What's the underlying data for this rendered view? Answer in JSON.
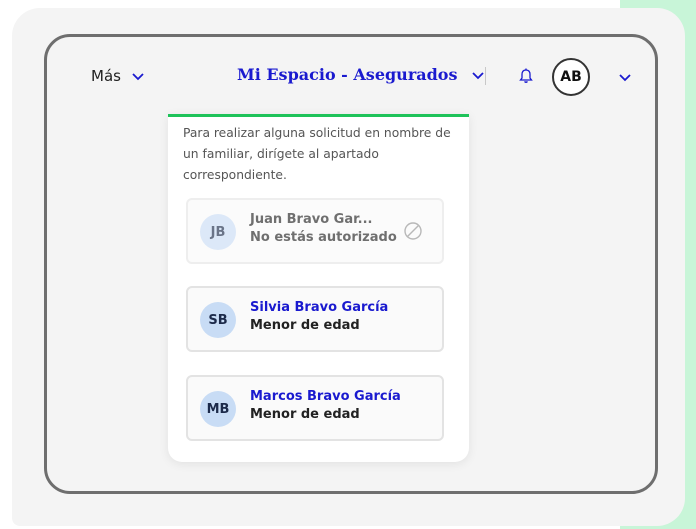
{
  "nav": {
    "mas_label": "Más",
    "space_label": "Mi Espacio - Asegurados",
    "avatar_initials": "AB"
  },
  "panel": {
    "info_text": "Para realizar alguna solicitud en nombre de un familiar, dirígete al apartado correspondiente.",
    "members": [
      {
        "initials": "JB",
        "name": "Juan Bravo Gar...",
        "status": "No estás autorizado",
        "disabled": true
      },
      {
        "initials": "SB",
        "name": "Silvia Bravo García",
        "status": "Menor de edad",
        "disabled": false
      },
      {
        "initials": "MB",
        "name": "Marcos Bravo García",
        "status": "Menor de edad",
        "disabled": false
      }
    ]
  },
  "colors": {
    "accent": "#1a1acf",
    "brand_green": "#1ec35a",
    "avatar_bg": "#c8dcf5"
  },
  "icons": [
    "chevron-down-icon",
    "bell-icon",
    "ban-icon"
  ]
}
